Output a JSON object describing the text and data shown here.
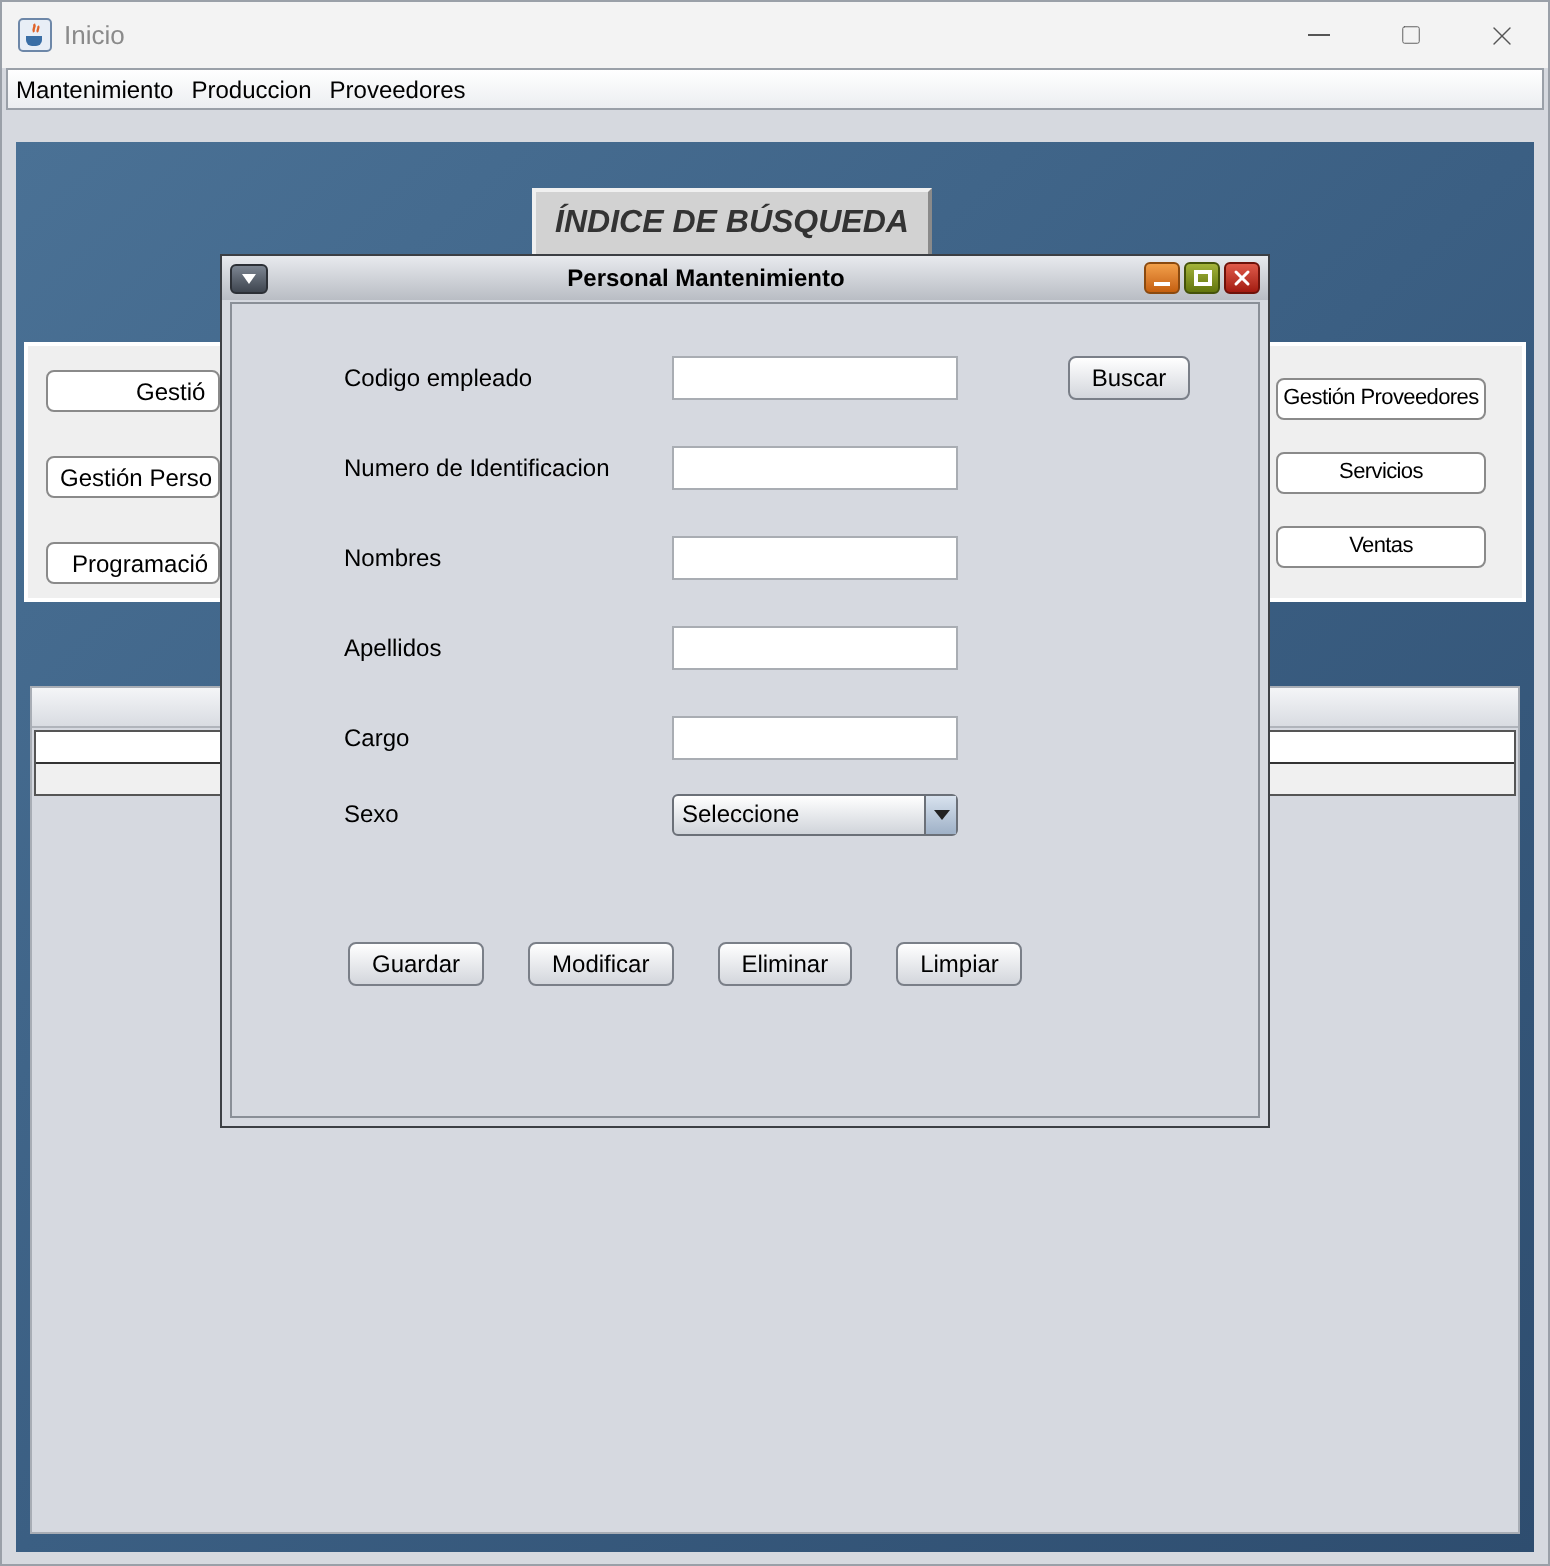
{
  "window": {
    "title": "Inicio"
  },
  "menu": [
    "Mantenimiento",
    "Produccion",
    "Proveedores"
  ],
  "desktop": {
    "header": "ÍNDICE DE BÚSQUEDA",
    "left_buttons": [
      "Gestió",
      "Gestión Perso",
      "Programació"
    ],
    "right_buttons": [
      "Gestión Proveedores",
      "Servicios",
      "Ventas"
    ]
  },
  "dialog": {
    "title": "Personal Mantenimiento",
    "fields": [
      {
        "label": "Codigo empleado",
        "kind": "text"
      },
      {
        "label": "Numero de Identificacion",
        "kind": "text"
      },
      {
        "label": "Nombres",
        "kind": "text"
      },
      {
        "label": "Apellidos",
        "kind": "text"
      },
      {
        "label": "Cargo",
        "kind": "text"
      },
      {
        "label": "Sexo",
        "kind": "combo",
        "value": "Seleccione"
      }
    ],
    "search_button": "Buscar",
    "buttons": [
      "Guardar",
      "Modificar",
      "Eliminar",
      "Limpiar"
    ]
  }
}
